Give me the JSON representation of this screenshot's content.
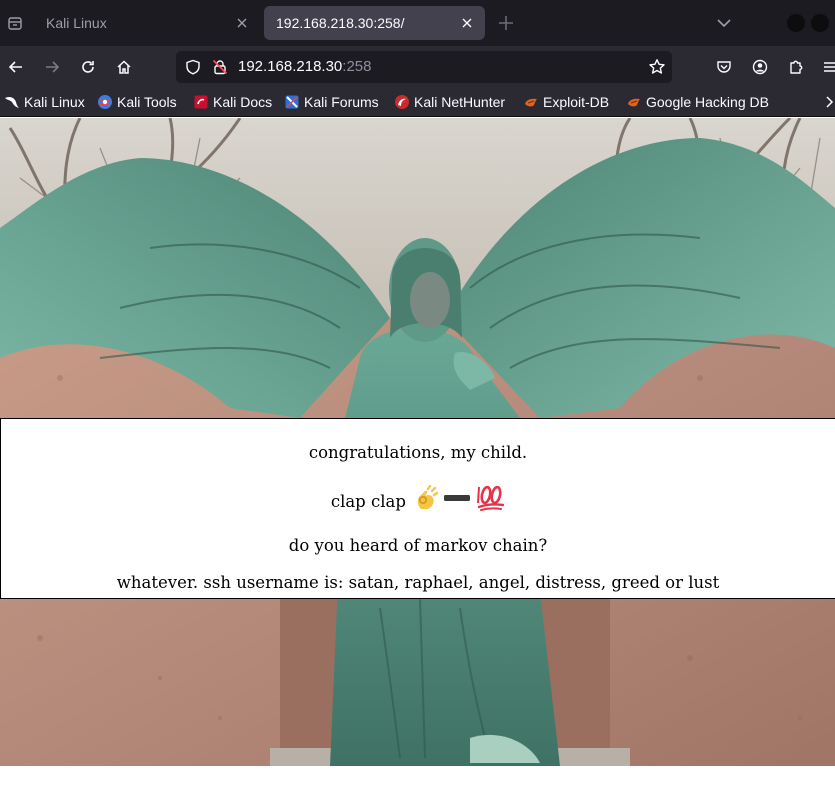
{
  "browser": {
    "tabs": [
      {
        "label": "Kali Linux",
        "active": false
      },
      {
        "label": "192.168.218.30:258/",
        "active": true
      }
    ],
    "url": {
      "host": "192.168.218.30",
      "port": ":258"
    },
    "bookmarks": [
      {
        "label": "Kali Linux",
        "icon": "kali-dragon-icon"
      },
      {
        "label": "Kali Tools",
        "icon": "kali-tools-icon"
      },
      {
        "label": "Kali Docs",
        "icon": "kali-docs-icon"
      },
      {
        "label": "Kali Forums",
        "icon": "kali-forums-icon"
      },
      {
        "label": "Kali NetHunter",
        "icon": "kali-nethunter-icon"
      },
      {
        "label": "Exploit-DB",
        "icon": "exploit-db-icon"
      },
      {
        "label": "Google Hacking DB",
        "icon": "ghdb-icon"
      }
    ]
  },
  "page": {
    "lines": [
      "congratulations, my child.",
      "clap clap",
      "do you heard of markov chain?",
      "whatever. ssh username is: satan, raphael, angel, distress, greed or lust"
    ],
    "emojis": [
      "ok-hand-emoji",
      "heavy-minus-emoji",
      "hundred-points-emoji"
    ]
  },
  "colors": {
    "tabstrip": "#1c1b22",
    "toolbar": "#2b2a33",
    "active_tab": "#42414d",
    "verdigris": "#5e9c8c",
    "granite": "#b58b78"
  }
}
